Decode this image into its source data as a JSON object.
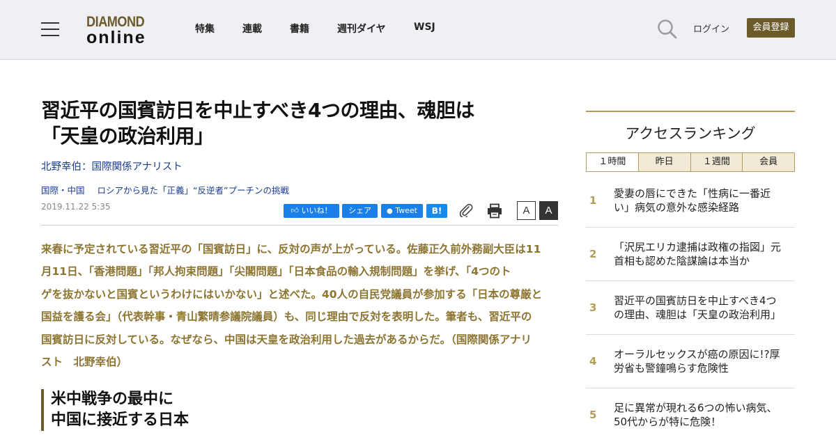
{
  "header": {
    "logo_top": "DIAMOND",
    "logo_bottom": "online",
    "nav": [
      "特集",
      "連載",
      "書籍",
      "週刊ダイヤ",
      "WSJ"
    ],
    "login": "ログイン",
    "register": "会員登録"
  },
  "article": {
    "title_lines": [
      "習近平の国賓訪日を中止すべき4つの理由、魂胆は",
      "「天皇の政治利用」"
    ],
    "author": "北野幸伯：国際関係アナリスト",
    "category": "国際・中国",
    "series": "ロシアから見た「正義」“反逆者”プーチンの挑戦",
    "date": "2019.11.22 5:35",
    "share": {
      "like": "いいね！",
      "share": "シェア",
      "tweet": "Tweet",
      "hatena": "B!"
    },
    "font_small": "A",
    "font_large": "A",
    "lead_lines": [
      "来春に予定されている習近平の「国賓訪日」に、反対の声が上がっている。佐藤正久前外務副大臣は11",
      "月11日、「香港問題」「邦人拘束問題」「尖閣問題」「日本食品の輸入規制問題」を挙げ、「4つのト",
      "ゲを抜かないと国賓というわけにはいかない」と述べた。40人の自民党議員が参加する「日本の尊厳と",
      "国益を護る会」（代表幹事・青山繁晴参議院議員）も、同じ理由で反対を表明した。筆者も、習近平の",
      "国賓訪日に反対している。なぜなら、中国は天皇を政治利用した過去があるからだ。（国際関係アナリ",
      "スト　北野幸伯）"
    ],
    "heading_lines": [
      "米中戦争の最中に",
      "中国に接近する日本"
    ]
  },
  "ranking": {
    "title": "アクセスランキング",
    "tabs": [
      "１時間",
      "昨日",
      "１週間",
      "会員"
    ],
    "items": [
      {
        "rank": "1",
        "lines": [
          "愛妻の唇にできた「性病に一番近",
          "い」病気の意外な感染経路"
        ]
      },
      {
        "rank": "2",
        "lines": [
          "「沢尻エリカ逮捕は政権の指図」元",
          "首相も認めた陰謀論は本当か"
        ]
      },
      {
        "rank": "3",
        "lines": [
          "習近平の国賓訪日を中止すべき4つ",
          "の理由、魂胆は「天皇の政治利用」"
        ]
      },
      {
        "rank": "4",
        "lines": [
          "オーラルセックスが癌の原因に!?厚",
          "労省も警鐘鳴らす危険性"
        ]
      },
      {
        "rank": "5",
        "lines": [
          "足に異常が現れる6つの怖い病気、",
          "50代からが特に危険！"
        ]
      }
    ]
  },
  "colors": {
    "brand": "#6b5a2a",
    "lead_text": "#8c7431",
    "link": "#1a3d8f",
    "rank_accent": "#b29c5a",
    "facebook": "#1a7fe6"
  }
}
